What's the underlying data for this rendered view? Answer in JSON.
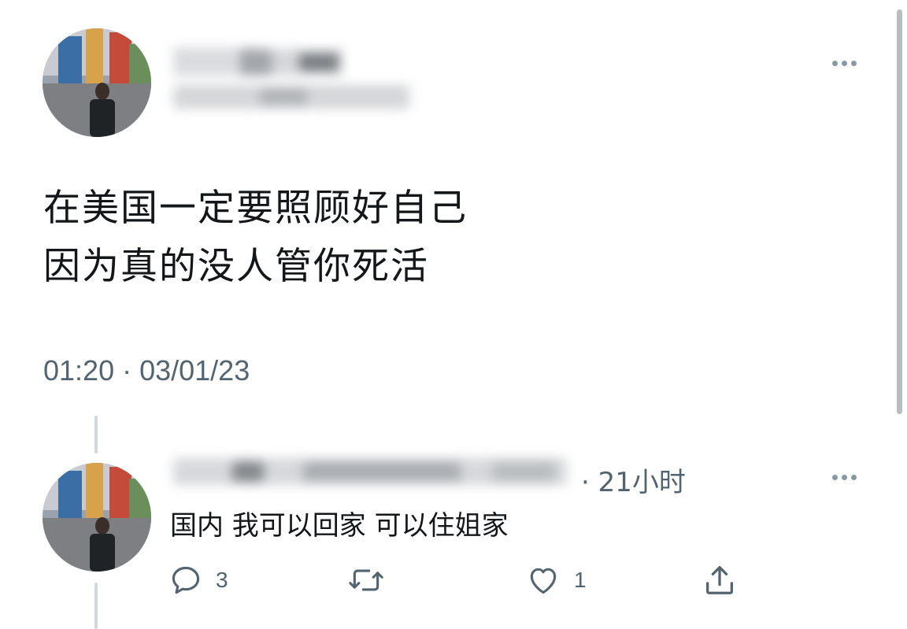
{
  "main_tweet": {
    "text_line_1": "在美国一定要照顾好自己",
    "text_line_2": "因为真的没人管你死活",
    "timestamp": "01:20 · 03/01/23"
  },
  "reply": {
    "time_ago": "· 21小时",
    "text": "国内 我可以回家 可以住姐家",
    "actions": {
      "reply_count": "3",
      "retweet_count": "",
      "like_count": "1"
    }
  },
  "icons": [
    "more-icon",
    "reply-icon",
    "retweet-icon",
    "like-icon",
    "share-icon"
  ],
  "colors": {
    "secondary_text": "#536471",
    "icon_gray": "#536471",
    "thread_line": "#cfd9de"
  }
}
